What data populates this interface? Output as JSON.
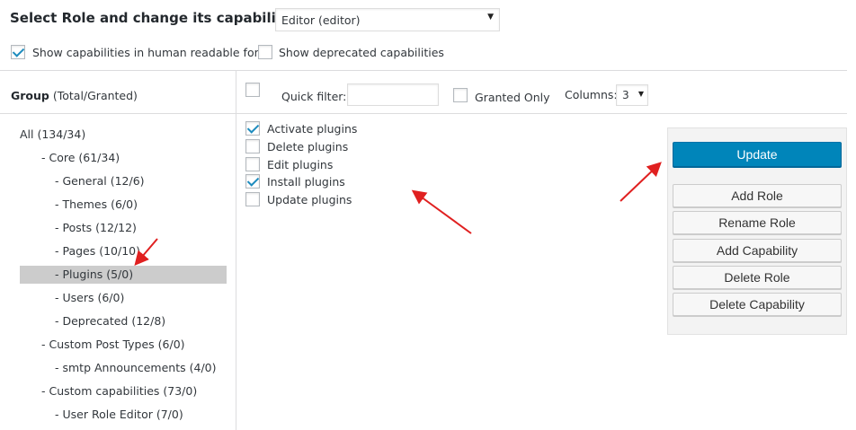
{
  "header": {
    "title": "Select Role and change its capabilities:",
    "role_select_value": "Editor (editor)",
    "human_readable_label": "Show capabilities in human readable form",
    "human_readable_checked": true,
    "deprecated_label": "Show deprecated capabilities",
    "deprecated_checked": false
  },
  "group_panel": {
    "heading_bold": "Group",
    "heading_rest": "(Total/Granted)",
    "items": [
      {
        "label": "All (134/34)",
        "selected": false
      },
      {
        "label": "- Core (61/34)",
        "selected": false
      },
      {
        "label": "- General (12/6)",
        "selected": false
      },
      {
        "label": "- Themes (6/0)",
        "selected": false
      },
      {
        "label": "- Posts (12/12)",
        "selected": false
      },
      {
        "label": "- Pages (10/10)",
        "selected": false
      },
      {
        "label": "- Plugins (5/0)",
        "selected": true
      },
      {
        "label": "- Users (6/0)",
        "selected": false
      },
      {
        "label": "- Deprecated (12/8)",
        "selected": false
      },
      {
        "label": "- Custom Post Types (6/0)",
        "selected": false
      },
      {
        "label": "- smtp Announcements (4/0)",
        "selected": false
      },
      {
        "label": "- Custom capabilities (73/0)",
        "selected": false
      },
      {
        "label": "- User Role Editor (7/0)",
        "selected": false
      }
    ]
  },
  "toolbar": {
    "quick_filter_label": "Quick filter:",
    "quick_filter_value": "",
    "granted_only_label": "Granted Only",
    "granted_only_checked": false,
    "columns_label": "Columns:",
    "columns_value": "3"
  },
  "capabilities": [
    {
      "label": "Activate plugins",
      "checked": true
    },
    {
      "label": "Delete plugins",
      "checked": false
    },
    {
      "label": "Edit plugins",
      "checked": false
    },
    {
      "label": "Install plugins",
      "checked": true
    },
    {
      "label": "Update plugins",
      "checked": false
    }
  ],
  "actions": {
    "update": "Update",
    "add_role": "Add Role",
    "rename_role": "Rename Role",
    "add_capability": "Add Capability",
    "delete_role": "Delete Role",
    "delete_capability": "Delete Capability"
  },
  "colors": {
    "primary_button": "#0085ba",
    "check_mark": "#1e8cbe",
    "annotation_arrow": "#e02020",
    "selected_row": "#cccccc"
  }
}
